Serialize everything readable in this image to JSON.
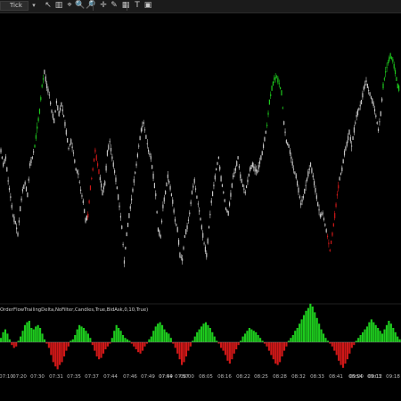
{
  "toolbar": {
    "instrument_value": "Tick",
    "tools": [
      {
        "name": "pointer-icon",
        "glyph": "↖"
      },
      {
        "name": "bar-chart-icon",
        "glyph": "▥"
      },
      {
        "name": "measure-icon",
        "glyph": "⌖"
      },
      {
        "name": "zoom-in-icon",
        "glyph": "🔍"
      },
      {
        "name": "zoom-out-icon",
        "glyph": "🔎"
      },
      {
        "name": "crosshair-icon",
        "glyph": "✛"
      },
      {
        "name": "pencil-icon",
        "glyph": "✎"
      },
      {
        "name": "tile-icon",
        "glyph": "▦"
      },
      {
        "name": "text-icon",
        "glyph": "T"
      },
      {
        "name": "screenshot-icon",
        "glyph": "▣"
      }
    ]
  },
  "indicator_label": "OrderFlowTrailingDelta,NoFilter,Candles,True,BidAsk,0,10,True)",
  "time_axis": {
    "labels": [
      "07:10",
      "07:20",
      "07:30",
      "07:31",
      "07:35",
      "07:37",
      "07:44",
      "07:46",
      "07:49",
      "07:54",
      "07:57",
      "07:49",
      "08:00",
      "08:05",
      "08:16",
      "08:22",
      "08:25",
      "08:28",
      "08:32",
      "08:33",
      "08:41",
      "08:54",
      "09:00",
      "09:03",
      "09:12",
      "09:18"
    ]
  },
  "colors": {
    "background": "#000000",
    "candle": "#c8c8c8",
    "up": "#1ecb1e",
    "down": "#d01818",
    "zero_line": "#777777"
  },
  "chart_data": {
    "type": "line",
    "price_path": [
      0.58,
      0.52,
      0.55,
      0.45,
      0.38,
      0.3,
      0.27,
      0.22,
      0.33,
      0.41,
      0.44,
      0.39,
      0.52,
      0.55,
      0.6,
      0.68,
      0.75,
      0.86,
      0.92,
      0.86,
      0.82,
      0.75,
      0.71,
      0.79,
      0.74,
      0.78,
      0.73,
      0.66,
      0.59,
      0.62,
      0.57,
      0.5,
      0.48,
      0.41,
      0.36,
      0.28,
      0.3,
      0.42,
      0.5,
      0.58,
      0.52,
      0.46,
      0.4,
      0.44,
      0.57,
      0.62,
      0.55,
      0.49,
      0.42,
      0.34,
      0.25,
      0.1,
      0.22,
      0.3,
      0.37,
      0.45,
      0.52,
      0.6,
      0.67,
      0.7,
      0.64,
      0.58,
      0.55,
      0.47,
      0.39,
      0.24,
      0.21,
      0.34,
      0.4,
      0.47,
      0.42,
      0.36,
      0.28,
      0.24,
      0.13,
      0.11,
      0.21,
      0.25,
      0.31,
      0.4,
      0.45,
      0.38,
      0.32,
      0.25,
      0.18,
      0.13,
      0.25,
      0.36,
      0.43,
      0.5,
      0.55,
      0.46,
      0.4,
      0.33,
      0.31,
      0.39,
      0.47,
      0.5,
      0.55,
      0.47,
      0.43,
      0.4,
      0.45,
      0.5,
      0.52,
      0.5,
      0.49,
      0.53,
      0.57,
      0.63,
      0.69,
      0.79,
      0.85,
      0.89,
      0.9,
      0.87,
      0.83,
      0.7,
      0.62,
      0.6,
      0.55,
      0.5,
      0.47,
      0.41,
      0.35,
      0.38,
      0.43,
      0.48,
      0.52,
      0.47,
      0.41,
      0.35,
      0.3,
      0.31,
      0.26,
      0.21,
      0.15,
      0.22,
      0.3,
      0.39,
      0.46,
      0.5,
      0.57,
      0.61,
      0.66,
      0.6,
      0.67,
      0.73,
      0.76,
      0.79,
      0.85,
      0.88,
      0.84,
      0.81,
      0.78,
      0.73,
      0.67,
      0.74,
      0.86,
      0.92,
      0.96,
      0.99,
      0.97,
      0.92,
      0.86,
      0.84
    ],
    "up_highlight_segments": [
      [
        14,
        17
      ],
      [
        110,
        116
      ],
      [
        158,
        164
      ]
    ],
    "down_highlight_segments": [
      [
        36,
        40
      ],
      [
        135,
        139
      ]
    ],
    "delta_bars": [
      3,
      7,
      9,
      6,
      2,
      -2,
      -4,
      -3,
      1,
      4,
      8,
      12,
      14,
      15,
      10,
      9,
      11,
      12,
      10,
      6,
      2,
      -1,
      -4,
      -9,
      -14,
      -17,
      -19,
      -16,
      -14,
      -10,
      -6,
      -3,
      1,
      2,
      5,
      9,
      12,
      11,
      10,
      8,
      6,
      3,
      -2,
      -6,
      -10,
      -12,
      -11,
      -8,
      -5,
      -3,
      -1,
      3,
      8,
      12,
      10,
      8,
      5,
      3,
      2,
      1,
      -1,
      -3,
      -5,
      -7,
      -8,
      -6,
      -3,
      -1,
      2,
      4,
      8,
      11,
      13,
      14,
      12,
      9,
      7,
      6,
      3,
      -1,
      -4,
      -8,
      -12,
      -16,
      -14,
      -10,
      -6,
      -3,
      1,
      4,
      7,
      9,
      11,
      13,
      14,
      12,
      10,
      7,
      4,
      1,
      -1,
      -4,
      -6,
      -9,
      -13,
      -15,
      -12,
      -8,
      -5,
      -2,
      1,
      4,
      6,
      8,
      10,
      9,
      8,
      7,
      5,
      3,
      1,
      -1,
      -3,
      -6,
      -9,
      -12,
      -15,
      -16,
      -14,
      -10,
      -6,
      -3,
      1,
      3,
      5,
      8,
      10,
      13,
      16,
      19,
      22,
      24,
      27,
      25,
      21,
      17,
      13,
      9,
      6,
      3,
      1,
      -1,
      -3,
      -6,
      -9,
      -13,
      -16,
      -18,
      -15,
      -12,
      -8,
      -4,
      -2,
      1,
      3,
      5,
      7,
      9,
      11,
      14,
      16,
      14,
      12,
      10,
      8,
      6,
      9,
      12,
      15,
      13,
      10,
      7,
      4,
      2
    ]
  }
}
